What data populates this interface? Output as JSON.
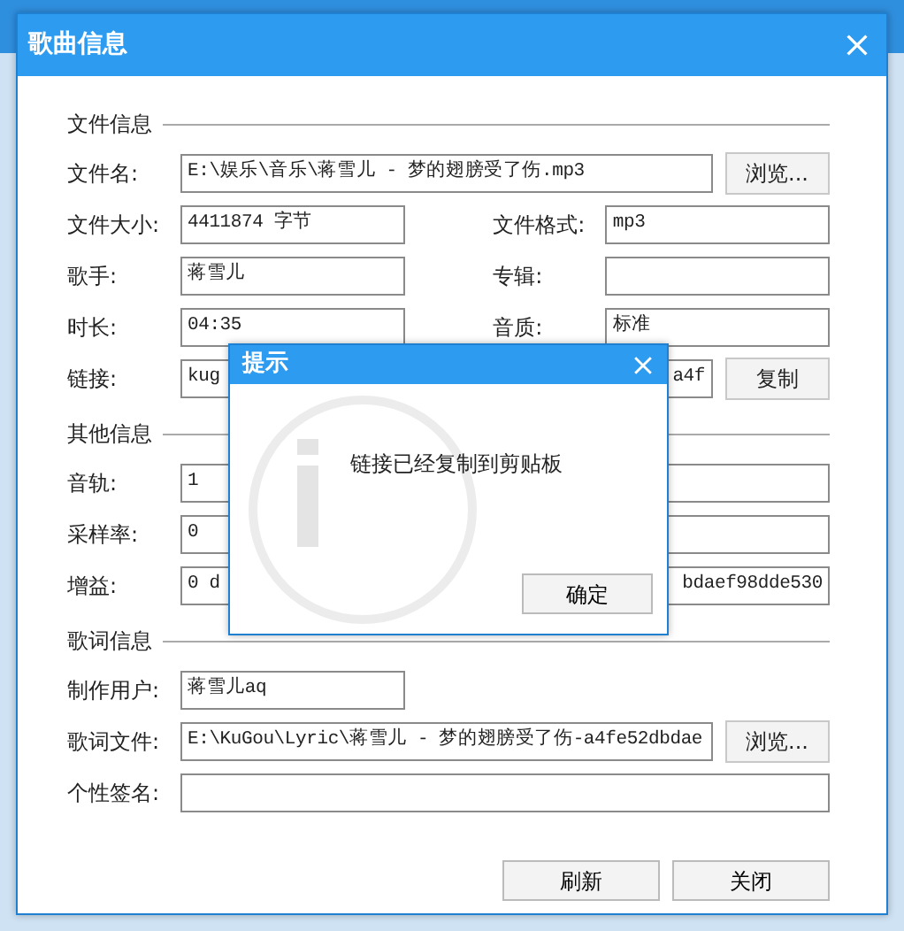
{
  "dialog": {
    "title": "歌曲信息"
  },
  "sections": [
    {
      "heading": "文件信息",
      "rows": [
        {
          "kind": "wide",
          "label": "文件名:",
          "value": "E:\\娱乐\\音乐\\蒋雪儿 - 梦的翅膀受了伤.mp3",
          "button": "浏览..."
        },
        {
          "kind": "pair",
          "label": "文件大小:",
          "value": "4411874 字节",
          "right_label": "文件格式:",
          "right_value": "mp3"
        },
        {
          "kind": "pair",
          "label": "歌手:",
          "value": "蒋雪儿",
          "right_label": "专辑:",
          "right_value": ""
        },
        {
          "kind": "pair",
          "label": "时长:",
          "value": "04:35",
          "right_label": "音质:",
          "right_value": "标准"
        },
        {
          "kind": "covered",
          "label": "链接:",
          "value_left": "kug",
          "value_right": "a4f",
          "button": "复制"
        }
      ]
    },
    {
      "heading": "其他信息",
      "rows": [
        {
          "kind": "pair",
          "label": "音轨:",
          "value": "1",
          "right_value": ""
        },
        {
          "kind": "pair",
          "label": "采样率:",
          "value": "0",
          "right_value": ""
        },
        {
          "kind": "pair",
          "label": "增益:",
          "value": "0 d",
          "right_value": "bdaef98dde530"
        }
      ]
    },
    {
      "heading": "歌词信息",
      "rows": [
        {
          "kind": "single",
          "label": "制作用户:",
          "value": "蒋雪儿aq"
        },
        {
          "kind": "wide",
          "label": "歌词文件:",
          "value": "E:\\KuGou\\Lyric\\蒋雪儿 - 梦的翅膀受了伤-a4fe52dbdae",
          "button": "浏览..."
        },
        {
          "kind": "full",
          "label": "个性签名:",
          "value": ""
        }
      ]
    }
  ],
  "footer_buttons": [
    "刷新",
    "关闭"
  ],
  "popup": {
    "title": "提示",
    "message": "链接已经复制到剪贴板",
    "button": "确定"
  }
}
